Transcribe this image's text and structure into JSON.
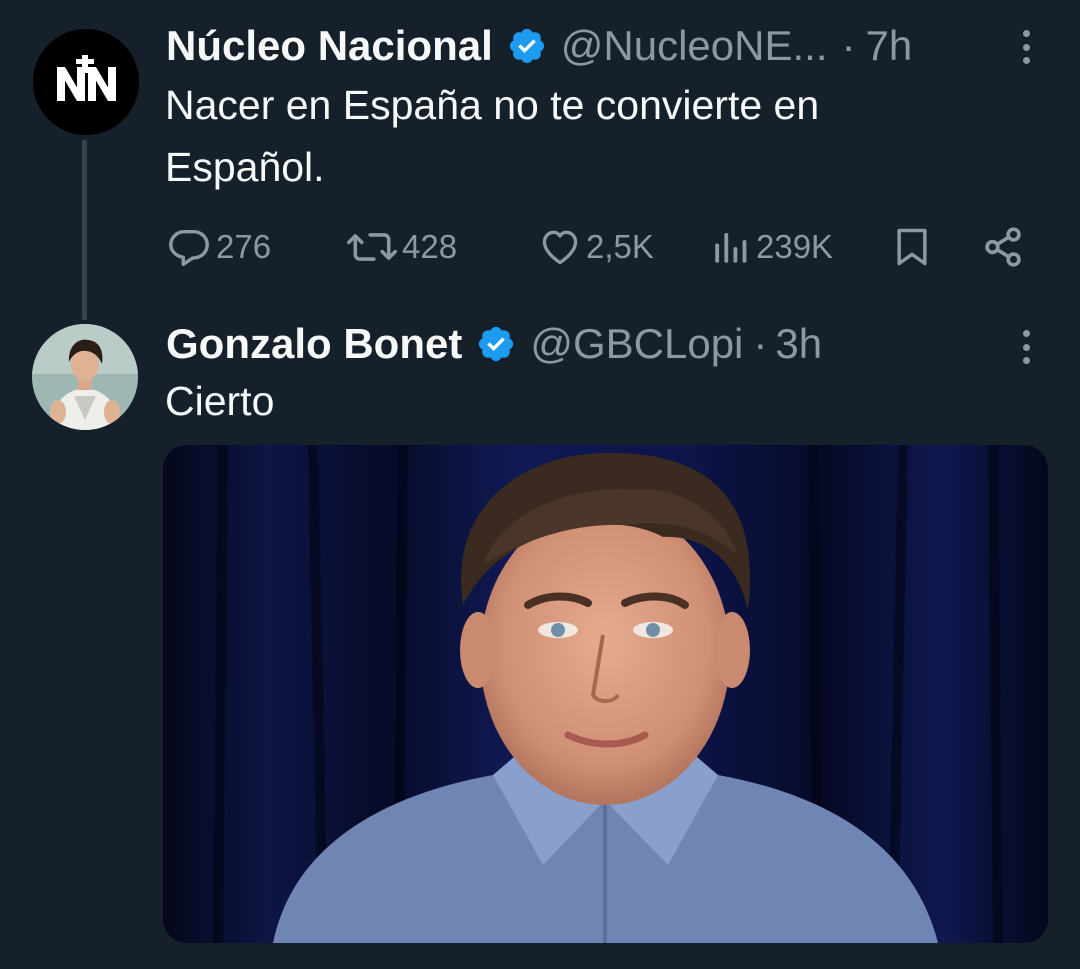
{
  "thread": {
    "parent": {
      "display_name": "Núcleo Nacional",
      "handle": "@NucleoNE...",
      "separator": "·",
      "time": "7h",
      "avatar_text": "NN",
      "text_line1": "Nacer en España no te convierte en",
      "text_line2": "Español.",
      "actions": {
        "replies": "276",
        "reposts": "428",
        "likes": "2,5K",
        "views": "239K"
      }
    },
    "reply": {
      "display_name": "Gonzalo Bonet",
      "handle": "@GBCLopi",
      "separator": "·",
      "time": "3h",
      "text": "Cierto"
    }
  },
  "colors": {
    "background": "#15202b",
    "text_primary": "#f7f9f9",
    "text_secondary": "#8b98a5",
    "verified_badge": "#1d9bf0",
    "thread_line": "#38444d"
  },
  "icons": {
    "verified": "verified-badge-icon",
    "more": "more-options-icon",
    "reply": "reply-icon",
    "repost": "repost-icon",
    "like": "like-icon",
    "views": "views-icon",
    "bookmark": "bookmark-icon",
    "share": "share-icon"
  }
}
